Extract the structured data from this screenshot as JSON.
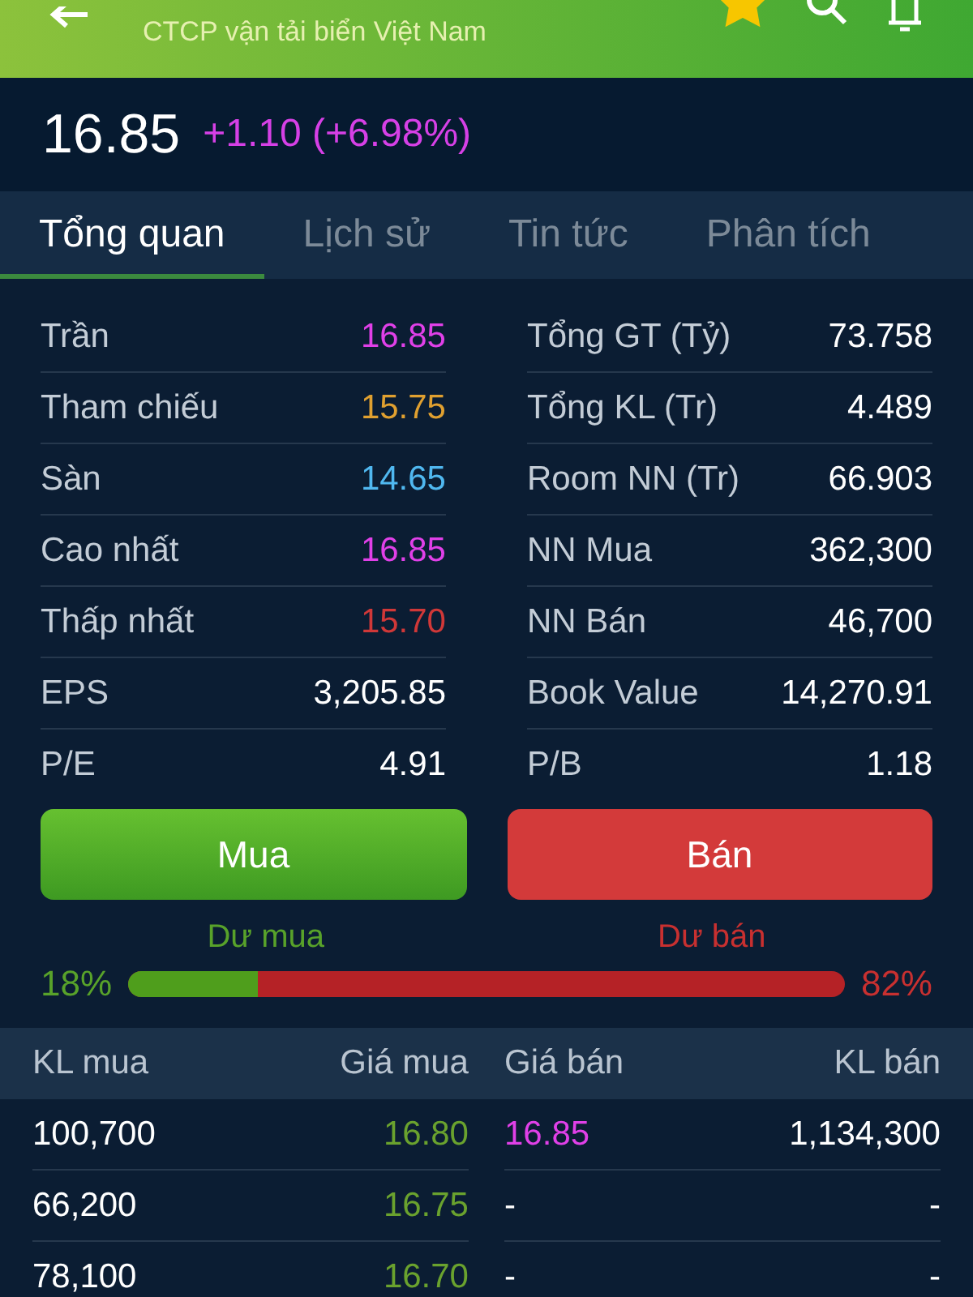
{
  "header": {
    "subtitle": "CTCP vận tải biển Việt Nam",
    "favorite": true
  },
  "quote": {
    "price": "16.85",
    "change": "+1.10 (+6.98%)"
  },
  "tabs": [
    {
      "label": "Tổng quan",
      "selected": true
    },
    {
      "label": "Lịch sử",
      "selected": false
    },
    {
      "label": "Tin tức",
      "selected": false
    },
    {
      "label": "Phân tích",
      "selected": false
    }
  ],
  "stats_left": [
    {
      "label": "Trần",
      "value": "16.85",
      "color": "#e040e8"
    },
    {
      "label": "Tham chiếu",
      "value": "15.75",
      "color": "#e0a030"
    },
    {
      "label": "Sàn",
      "value": "14.65",
      "color": "#50b8f0"
    },
    {
      "label": "Cao nhất",
      "value": "16.85",
      "color": "#e040e8"
    },
    {
      "label": "Thấp nhất",
      "value": "15.70",
      "color": "#d03838"
    },
    {
      "label": "EPS",
      "value": "3,205.85",
      "color": "#ffffff"
    },
    {
      "label": "P/E",
      "value": "4.91",
      "color": "#ffffff"
    }
  ],
  "stats_right": [
    {
      "label": "Tổng GT (Tỷ)",
      "value": "73.758"
    },
    {
      "label": "Tổng KL (Tr)",
      "value": "4.489"
    },
    {
      "label": "Room NN (Tr)",
      "value": "66.903"
    },
    {
      "label": "NN Mua",
      "value": "362,300"
    },
    {
      "label": "NN Bán",
      "value": "46,700"
    },
    {
      "label": "Book Value",
      "value": "14,270.91"
    },
    {
      "label": "P/B",
      "value": "1.18"
    }
  ],
  "buttons": {
    "buy": "Mua",
    "sell": "Bán"
  },
  "balance": {
    "buy_label": "Dư mua",
    "sell_label": "Dư bán",
    "buy_percent": "18%",
    "sell_percent": "82%",
    "level": 0.18
  },
  "order_book": {
    "columns": [
      "KL mua",
      "Giá mua",
      "Giá bán",
      "KL bán"
    ],
    "rows": [
      {
        "bid_volume": "100,700",
        "bid_price": "16.80",
        "ask_price": "16.85",
        "ask_volume": "1,134,300",
        "color": "#e040e8"
      },
      {
        "bid_volume": "66,200",
        "bid_price": "16.75",
        "ask_price": "-",
        "ask_volume": "-",
        "color": "#ffffff"
      },
      {
        "bid_volume": "78,100",
        "bid_price": "16.70",
        "ask_price": "-",
        "ask_volume": "-",
        "color": "#ffffff"
      }
    ]
  }
}
